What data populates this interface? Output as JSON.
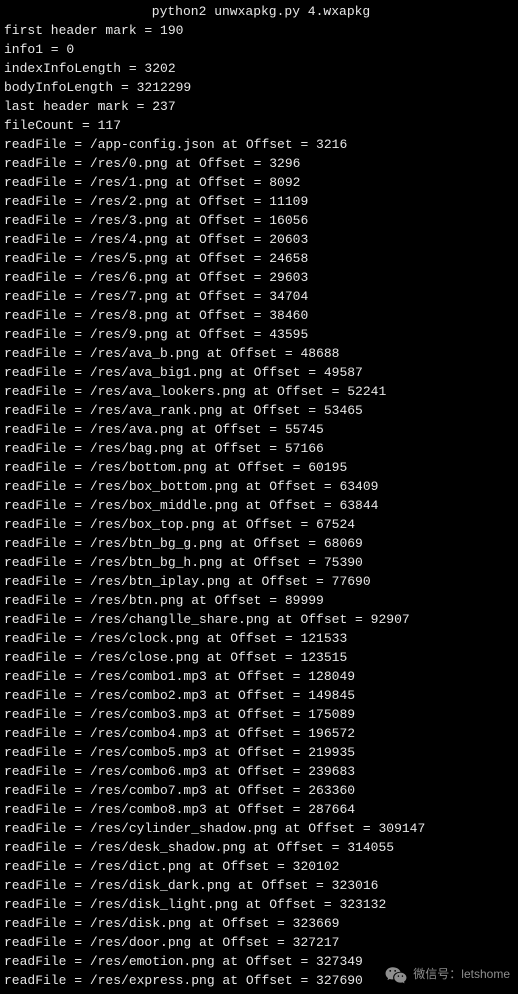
{
  "command": "python2 unwxapkg.py 4.wxapkg",
  "header": {
    "first_header_mark": "first header mark = 190",
    "info1": "info1 = 0",
    "indexInfoLength": "indexInfoLength = 3202",
    "bodyInfoLength": "bodyInfoLength = 3212299",
    "last_header_mark": "last header mark = 237",
    "fileCount": "fileCount = 117"
  },
  "lines": [
    "readFile = /app-config.json at Offset = 3216",
    "readFile = /res/0.png at Offset = 3296",
    "readFile = /res/1.png at Offset = 8092",
    "readFile = /res/2.png at Offset = 11109",
    "readFile = /res/3.png at Offset = 16056",
    "readFile = /res/4.png at Offset = 20603",
    "readFile = /res/5.png at Offset = 24658",
    "readFile = /res/6.png at Offset = 29603",
    "readFile = /res/7.png at Offset = 34704",
    "readFile = /res/8.png at Offset = 38460",
    "readFile = /res/9.png at Offset = 43595",
    "readFile = /res/ava_b.png at Offset = 48688",
    "readFile = /res/ava_big1.png at Offset = 49587",
    "readFile = /res/ava_lookers.png at Offset = 52241",
    "readFile = /res/ava_rank.png at Offset = 53465",
    "readFile = /res/ava.png at Offset = 55745",
    "readFile = /res/bag.png at Offset = 57166",
    "readFile = /res/bottom.png at Offset = 60195",
    "readFile = /res/box_bottom.png at Offset = 63409",
    "readFile = /res/box_middle.png at Offset = 63844",
    "readFile = /res/box_top.png at Offset = 67524",
    "readFile = /res/btn_bg_g.png at Offset = 68069",
    "readFile = /res/btn_bg_h.png at Offset = 75390",
    "readFile = /res/btn_iplay.png at Offset = 77690",
    "readFile = /res/btn.png at Offset = 89999",
    "readFile = /res/changlle_share.png at Offset = 92907",
    "readFile = /res/clock.png at Offset = 121533",
    "readFile = /res/close.png at Offset = 123515",
    "readFile = /res/combo1.mp3 at Offset = 128049",
    "readFile = /res/combo2.mp3 at Offset = 149845",
    "readFile = /res/combo3.mp3 at Offset = 175089",
    "readFile = /res/combo4.mp3 at Offset = 196572",
    "readFile = /res/combo5.mp3 at Offset = 219935",
    "readFile = /res/combo6.mp3 at Offset = 239683",
    "readFile = /res/combo7.mp3 at Offset = 263360",
    "readFile = /res/combo8.mp3 at Offset = 287664",
    "readFile = /res/cylinder_shadow.png at Offset = 309147",
    "readFile = /res/desk_shadow.png at Offset = 314055",
    "readFile = /res/dict.png at Offset = 320102",
    "readFile = /res/disk_dark.png at Offset = 323016",
    "readFile = /res/disk_light.png at Offset = 323132",
    "readFile = /res/disk.png at Offset = 323669",
    "readFile = /res/door.png at Offset = 327217",
    "readFile = /res/emotion.png at Offset = 327349",
    "readFile = /res/express.png at Offset = 327690"
  ],
  "watermark": {
    "label": "微信号：letshome"
  }
}
